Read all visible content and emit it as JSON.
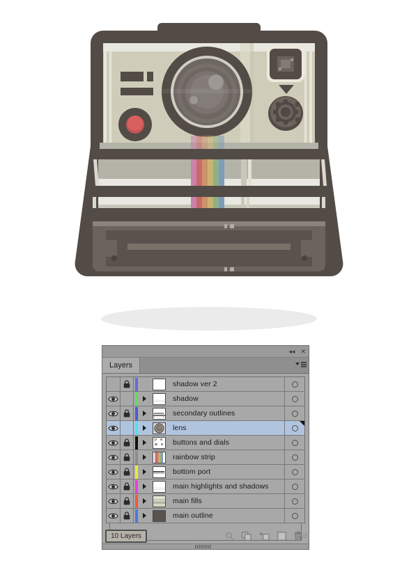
{
  "illustration": {
    "name": "polaroid-camera-illustration",
    "colors": {
      "outline": "#534b45",
      "body_light": "#e8e8e0",
      "body_mid": "#cfcdb9",
      "body_gray": "#b3b3a7",
      "panel_dark": "#6b635c",
      "panel_darker": "#5a524c",
      "lens_outer": "#5a524c",
      "lens_ring": "#cfcdc4",
      "lens_mid": "#6e6661",
      "lens_inner": "#7a7370",
      "lens_highlight": "#9b9591",
      "red_button": "#d8605e",
      "shadow_ellipse": "#ebebeb"
    },
    "rainbow": [
      "#c882ab",
      "#cd6868",
      "#cc9468",
      "#cbb272",
      "#8fb184",
      "#7f9cbc"
    ]
  },
  "panel": {
    "title": "Layers",
    "collapse_label": "◂◂",
    "close_label": "✕",
    "menu_icon": "panel-menu-icon",
    "footer_count": "10 Layers",
    "footer_buttons": [
      {
        "name": "locate-object-button",
        "icon": "magnifier-icon"
      },
      {
        "name": "make-clipping-mask-button",
        "icon": "clipping-mask-icon"
      },
      {
        "name": "create-new-sublayer-button",
        "icon": "new-sublayer-icon"
      },
      {
        "name": "create-new-layer-button",
        "icon": "new-layer-icon"
      },
      {
        "name": "delete-selection-button",
        "icon": "trash-icon"
      }
    ],
    "layers": [
      {
        "name": "shadow ver 2",
        "visible": false,
        "locked": true,
        "expandable": false,
        "selected": false,
        "color": "#5b6ee0",
        "thumb": "solid-white"
      },
      {
        "name": "shadow",
        "visible": true,
        "locked": false,
        "expandable": true,
        "selected": false,
        "color": "#5ce05b",
        "thumb": "faint-band"
      },
      {
        "name": "secondary outlines",
        "visible": true,
        "locked": true,
        "expandable": true,
        "selected": false,
        "color": "#4a5ad8",
        "thumb": "outline-lines"
      },
      {
        "name": "lens",
        "visible": true,
        "locked": false,
        "expandable": true,
        "selected": true,
        "color": "#48e6f0",
        "thumb": "lens"
      },
      {
        "name": "buttons and dials",
        "visible": true,
        "locked": true,
        "expandable": true,
        "selected": false,
        "color": "#111111",
        "thumb": "dots"
      },
      {
        "name": "rainbow strip",
        "visible": true,
        "locked": true,
        "expandable": true,
        "selected": false,
        "color": "#8d8d8d",
        "thumb": "rainbow"
      },
      {
        "name": "bottom port",
        "visible": true,
        "locked": true,
        "expandable": true,
        "selected": false,
        "color": "#f2e631",
        "thumb": "bar"
      },
      {
        "name": "main highlights and shadows",
        "visible": true,
        "locked": true,
        "expandable": true,
        "selected": false,
        "color": "#f03ce0",
        "thumb": "faint-band"
      },
      {
        "name": "main fills",
        "visible": true,
        "locked": true,
        "expandable": true,
        "selected": false,
        "color": "#f05a3c",
        "thumb": "fills"
      },
      {
        "name": "main outline",
        "visible": true,
        "locked": true,
        "expandable": true,
        "selected": false,
        "color": "#4a7ae0",
        "thumb": "dark-solid"
      }
    ]
  }
}
